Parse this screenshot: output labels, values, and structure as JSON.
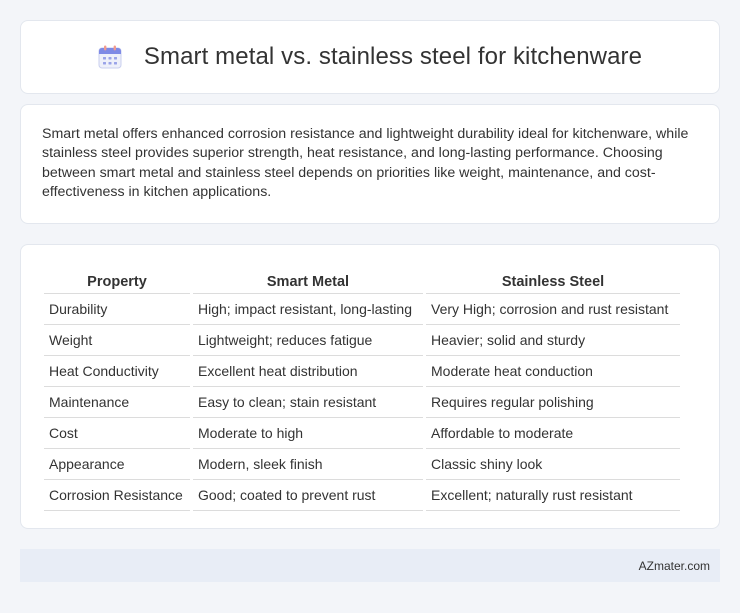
{
  "header": {
    "icon": "calendar-icon",
    "title": "Smart metal vs. stainless steel for kitchenware"
  },
  "description": "Smart metal offers enhanced corrosion resistance and lightweight durability ideal for kitchenware, while stainless steel provides superior strength, heat resistance, and long-lasting performance. Choosing between smart metal and stainless steel depends on priorities like weight, maintenance, and cost-effectiveness in kitchen applications.",
  "table": {
    "headers": [
      "Property",
      "Smart Metal",
      "Stainless Steel"
    ],
    "rows": [
      [
        "Durability",
        "High; impact resistant, long-lasting",
        "Very High; corrosion and rust resistant"
      ],
      [
        "Weight",
        "Lightweight; reduces fatigue",
        "Heavier; solid and sturdy"
      ],
      [
        "Heat Conductivity",
        "Excellent heat distribution",
        "Moderate heat conduction"
      ],
      [
        "Maintenance",
        "Easy to clean; stain resistant",
        "Requires regular polishing"
      ],
      [
        "Cost",
        "Moderate to high",
        "Affordable to moderate"
      ],
      [
        "Appearance",
        "Modern, sleek finish",
        "Classic shiny look"
      ],
      [
        "Corrosion Resistance",
        "Good; coated to prevent rust",
        "Excellent; naturally rust resistant"
      ]
    ]
  },
  "footer": {
    "source": "AZmater.com"
  }
}
